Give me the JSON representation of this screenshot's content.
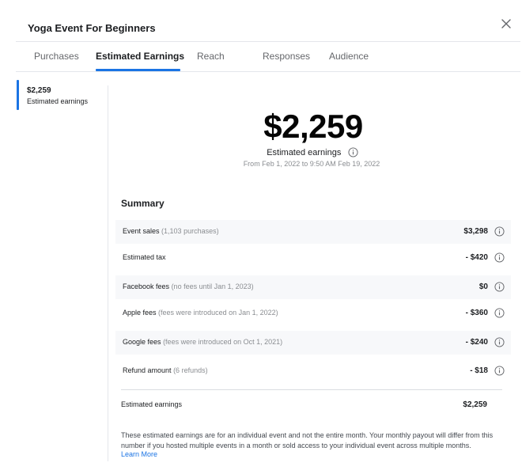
{
  "header": {
    "title": "Yoga Event For Beginners",
    "close_icon": "close-icon"
  },
  "tabs": [
    {
      "label": "Purchases",
      "active": false
    },
    {
      "label": "Estimated Earnings",
      "active": true
    },
    {
      "label": "Reach",
      "active": false
    },
    {
      "label": "Responses",
      "active": false
    },
    {
      "label": "Audience",
      "active": false
    }
  ],
  "sidebar": {
    "items": [
      {
        "value": "$2,259",
        "label": "Estimated earnings",
        "selected": true
      }
    ]
  },
  "hero": {
    "amount": "$2,259",
    "label": "Estimated earnings",
    "date_range": "From Feb 1, 2022 to 9:50 AM Feb 19, 2022"
  },
  "summary": {
    "title": "Summary",
    "rows": [
      {
        "label": "Event sales",
        "note": "(1,103 purchases)",
        "value": "$3,298"
      },
      {
        "label": "Estimated tax",
        "note": "",
        "value": "- $420"
      },
      {
        "label": "Facebook fees",
        "note": "(no fees until Jan 1, 2023)",
        "value": "$0"
      },
      {
        "label": "Apple fees",
        "note": "(fees were introduced on Jan 1, 2022)",
        "value": "- $360"
      },
      {
        "label": "Google fees",
        "note": "(fees were introduced on Oct 1, 2021)",
        "value": "- $240"
      },
      {
        "label": "Refund amount",
        "note": "(6 refunds)",
        "value": "- $18"
      }
    ],
    "total_label": "Estimated earnings",
    "total_value": "$2,259"
  },
  "footer": {
    "disclaimer": "These estimated earnings are for an individual event and not the entire month. Your monthly payout will differ from this number if you hosted multiple events in a month or sold access to your individual event across multiple months.",
    "learn_more": "Learn More"
  },
  "colors": {
    "accent": "#1b74e4",
    "row_shade": "#f7f8fa"
  }
}
